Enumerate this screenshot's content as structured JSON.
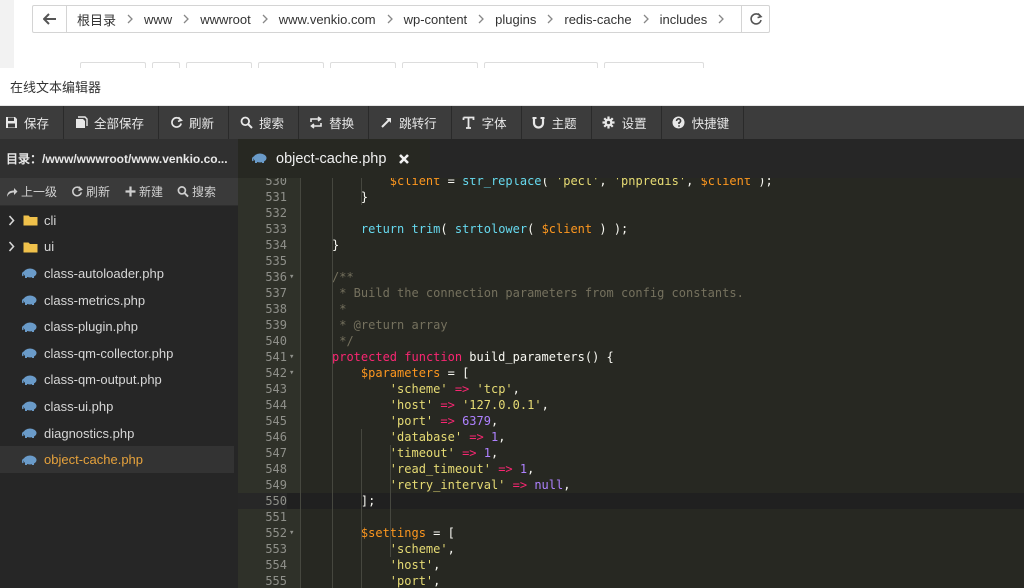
{
  "breadcrumb": {
    "items": [
      "根目录",
      "www",
      "wwwroot",
      "www.venkio.com",
      "wp-content",
      "plugins",
      "redis-cache",
      "includes"
    ]
  },
  "window": {
    "title": "在线文本编辑器"
  },
  "toolbar": {
    "buttons": [
      {
        "label": "保存",
        "icon": "save-icon"
      },
      {
        "label": "全部保存",
        "icon": "save-all-icon"
      },
      {
        "label": "刷新",
        "icon": "refresh-icon"
      },
      {
        "label": "搜索",
        "icon": "search-icon"
      },
      {
        "label": "替换",
        "icon": "replace-icon"
      },
      {
        "label": "跳转行",
        "icon": "jump-icon"
      },
      {
        "label": "字体",
        "icon": "font-icon"
      },
      {
        "label": "主题",
        "icon": "theme-icon"
      },
      {
        "label": "设置",
        "icon": "gear-icon"
      },
      {
        "label": "快捷键",
        "icon": "help-icon"
      }
    ]
  },
  "sidebar": {
    "dir_label": "目录：/www/wwwroot/www.venkio.co...",
    "actions": [
      {
        "label": "上一级",
        "icon": "share-icon"
      },
      {
        "label": "刷新",
        "icon": "refresh-icon"
      },
      {
        "label": "新建",
        "icon": "plus-icon"
      },
      {
        "label": "搜索",
        "icon": "search-icon"
      }
    ],
    "tree": [
      {
        "name": "cli",
        "type": "folder"
      },
      {
        "name": "ui",
        "type": "folder"
      },
      {
        "name": "class-autoloader.php",
        "type": "file"
      },
      {
        "name": "class-metrics.php",
        "type": "file"
      },
      {
        "name": "class-plugin.php",
        "type": "file"
      },
      {
        "name": "class-qm-collector.php",
        "type": "file"
      },
      {
        "name": "class-qm-output.php",
        "type": "file"
      },
      {
        "name": "class-ui.php",
        "type": "file"
      },
      {
        "name": "diagnostics.php",
        "type": "file"
      },
      {
        "name": "object-cache.php",
        "type": "file",
        "active": true
      }
    ]
  },
  "tab": {
    "title": "object-cache.php"
  },
  "colors": {
    "accent": "#e6a23c",
    "editor_bg": "#272822",
    "toolbar_bg": "#3c3c3c"
  },
  "code": {
    "current_line": 550,
    "lines": [
      {
        "n": "530",
        "fold": false,
        "tokens": [
          [
            "pl",
            "        "
          ],
          [
            "var",
            "$client"
          ],
          [
            "pl",
            " = "
          ],
          [
            "fn",
            "str_replace"
          ],
          [
            "pl",
            "( "
          ],
          [
            "str",
            "'pecl'"
          ],
          [
            "pl",
            ", "
          ],
          [
            "str",
            "'phpredis'"
          ],
          [
            "pl",
            ", "
          ],
          [
            "var",
            "$client"
          ],
          [
            "pl",
            " );"
          ]
        ]
      },
      {
        "n": "531",
        "fold": false,
        "tokens": [
          [
            "pl",
            "    }"
          ]
        ]
      },
      {
        "n": "532",
        "fold": false,
        "tokens": []
      },
      {
        "n": "533",
        "fold": false,
        "tokens": [
          [
            "pl",
            "    "
          ],
          [
            "fn",
            "return"
          ],
          [
            "pl",
            " "
          ],
          [
            "fn",
            "trim"
          ],
          [
            "pl",
            "( "
          ],
          [
            "fn",
            "strtolower"
          ],
          [
            "pl",
            "( "
          ],
          [
            "var",
            "$client"
          ],
          [
            "pl",
            " ) );"
          ]
        ]
      },
      {
        "n": "534",
        "fold": false,
        "tokens": [
          [
            "pl",
            "}"
          ]
        ]
      },
      {
        "n": "535",
        "fold": false,
        "tokens": []
      },
      {
        "n": "536",
        "fold": true,
        "tokens": [
          [
            "cm",
            "/**"
          ]
        ]
      },
      {
        "n": "537",
        "fold": false,
        "tokens": [
          [
            "cm",
            " * Build the connection parameters from config constants."
          ]
        ]
      },
      {
        "n": "538",
        "fold": false,
        "tokens": [
          [
            "cm",
            " *"
          ]
        ]
      },
      {
        "n": "539",
        "fold": false,
        "tokens": [
          [
            "cm",
            " * @return array"
          ]
        ]
      },
      {
        "n": "540",
        "fold": false,
        "tokens": [
          [
            "cm",
            " */"
          ]
        ]
      },
      {
        "n": "541",
        "fold": true,
        "tokens": [
          [
            "kw",
            "protected"
          ],
          [
            "pl",
            " "
          ],
          [
            "kw",
            "function"
          ],
          [
            "pl",
            " build_parameters() {"
          ]
        ]
      },
      {
        "n": "542",
        "fold": true,
        "tokens": [
          [
            "pl",
            "    "
          ],
          [
            "var",
            "$parameters"
          ],
          [
            "pl",
            " = ["
          ]
        ]
      },
      {
        "n": "543",
        "fold": false,
        "tokens": [
          [
            "pl",
            "        "
          ],
          [
            "str",
            "'scheme'"
          ],
          [
            "pl",
            " "
          ],
          [
            "kw",
            "=>"
          ],
          [
            "pl",
            " "
          ],
          [
            "str",
            "'tcp'"
          ],
          [
            "pl",
            ","
          ]
        ]
      },
      {
        "n": "544",
        "fold": false,
        "tokens": [
          [
            "pl",
            "        "
          ],
          [
            "str",
            "'host'"
          ],
          [
            "pl",
            " "
          ],
          [
            "kw",
            "=>"
          ],
          [
            "pl",
            " "
          ],
          [
            "str",
            "'127.0.0.1'"
          ],
          [
            "pl",
            ","
          ]
        ]
      },
      {
        "n": "545",
        "fold": false,
        "tokens": [
          [
            "pl",
            "        "
          ],
          [
            "str",
            "'port'"
          ],
          [
            "pl",
            " "
          ],
          [
            "kw",
            "=>"
          ],
          [
            "pl",
            " "
          ],
          [
            "num",
            "6379"
          ],
          [
            "pl",
            ","
          ]
        ]
      },
      {
        "n": "546",
        "fold": false,
        "tokens": [
          [
            "pl",
            "        "
          ],
          [
            "str",
            "'database'"
          ],
          [
            "pl",
            " "
          ],
          [
            "kw",
            "=>"
          ],
          [
            "pl",
            " "
          ],
          [
            "num",
            "1"
          ],
          [
            "pl",
            ","
          ]
        ]
      },
      {
        "n": "547",
        "fold": false,
        "tokens": [
          [
            "pl",
            "        "
          ],
          [
            "str",
            "'timeout'"
          ],
          [
            "pl",
            " "
          ],
          [
            "kw",
            "=>"
          ],
          [
            "pl",
            " "
          ],
          [
            "num",
            "1"
          ],
          [
            "pl",
            ","
          ]
        ]
      },
      {
        "n": "548",
        "fold": false,
        "tokens": [
          [
            "pl",
            "        "
          ],
          [
            "str",
            "'read_timeout'"
          ],
          [
            "pl",
            " "
          ],
          [
            "kw",
            "=>"
          ],
          [
            "pl",
            " "
          ],
          [
            "num",
            "1"
          ],
          [
            "pl",
            ","
          ]
        ]
      },
      {
        "n": "549",
        "fold": false,
        "tokens": [
          [
            "pl",
            "        "
          ],
          [
            "str",
            "'retry_interval'"
          ],
          [
            "pl",
            " "
          ],
          [
            "kw",
            "=>"
          ],
          [
            "pl",
            " "
          ],
          [
            "num",
            "null"
          ],
          [
            "pl",
            ","
          ]
        ]
      },
      {
        "n": "550",
        "fold": false,
        "tokens": [
          [
            "pl",
            "    ];"
          ]
        ]
      },
      {
        "n": "551",
        "fold": false,
        "tokens": []
      },
      {
        "n": "552",
        "fold": true,
        "tokens": [
          [
            "pl",
            "    "
          ],
          [
            "var",
            "$settings"
          ],
          [
            "pl",
            " = ["
          ]
        ]
      },
      {
        "n": "553",
        "fold": false,
        "tokens": [
          [
            "pl",
            "        "
          ],
          [
            "str",
            "'scheme'"
          ],
          [
            "pl",
            ","
          ]
        ]
      },
      {
        "n": "554",
        "fold": false,
        "tokens": [
          [
            "pl",
            "        "
          ],
          [
            "str",
            "'host'"
          ],
          [
            "pl",
            ","
          ]
        ]
      },
      {
        "n": "555",
        "fold": false,
        "tokens": [
          [
            "pl",
            "        "
          ],
          [
            "str",
            "'port'"
          ],
          [
            "pl",
            ","
          ]
        ]
      }
    ]
  }
}
